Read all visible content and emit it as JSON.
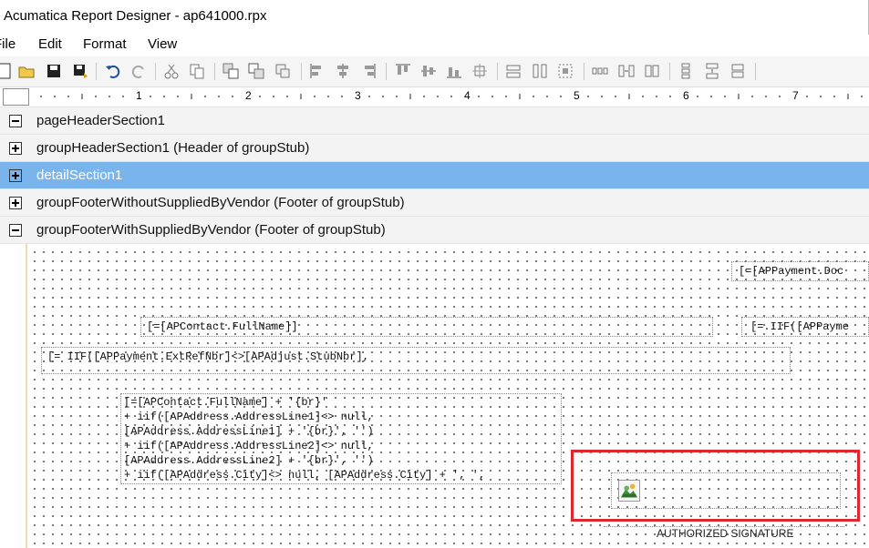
{
  "window": {
    "title": "Acumatica Report Designer - ap641000.rpx"
  },
  "menu": {
    "items": [
      "File",
      "Edit",
      "Format",
      "View"
    ]
  },
  "ruler": {
    "marks": [
      "1",
      "2",
      "3",
      "4",
      "5",
      "6",
      "7"
    ]
  },
  "sections": [
    {
      "label": "pageHeaderSection1",
      "state": "collapse",
      "selected": false
    },
    {
      "label": "groupHeaderSection1 (Header of groupStub)",
      "state": "expand",
      "selected": false
    },
    {
      "label": "detailSection1",
      "state": "expand",
      "selected": true
    },
    {
      "label": "groupFooterWithoutSuppliedByVendor (Footer of groupStub)",
      "state": "expand",
      "selected": false
    },
    {
      "label": "groupFooterWithSuppliedByVendor (Footer of groupStub)",
      "state": "collapse",
      "selected": false
    }
  ],
  "fields": {
    "doc": "[=[APPayment.Doc",
    "contact": "[=[APContact.FullName]]",
    "iif_right": "[=.IIF([APPayme",
    "extref": "[= IIF([APPayment.ExtRefNbr]<>[APAdjust.StubNbr],",
    "address_lines": [
      "[=[APContact.FullName] + '{br}'",
      "+ iif([APAddress.AddressLine1]<> null,",
      "[APAddress.AddressLine1] + '{br}', '')",
      "+ iif([APAddress.AddressLine2]<> null,",
      "[APAddress.AddressLine2] + '{br}', '')",
      "+ iif([APAddress.City]<> null, [APAddress.City] + ', ',"
    ],
    "signature": "AUTHORIZED SIGNATURE"
  },
  "colors": {
    "selected_section": "#79b4ec",
    "highlight": "#e0262e"
  }
}
